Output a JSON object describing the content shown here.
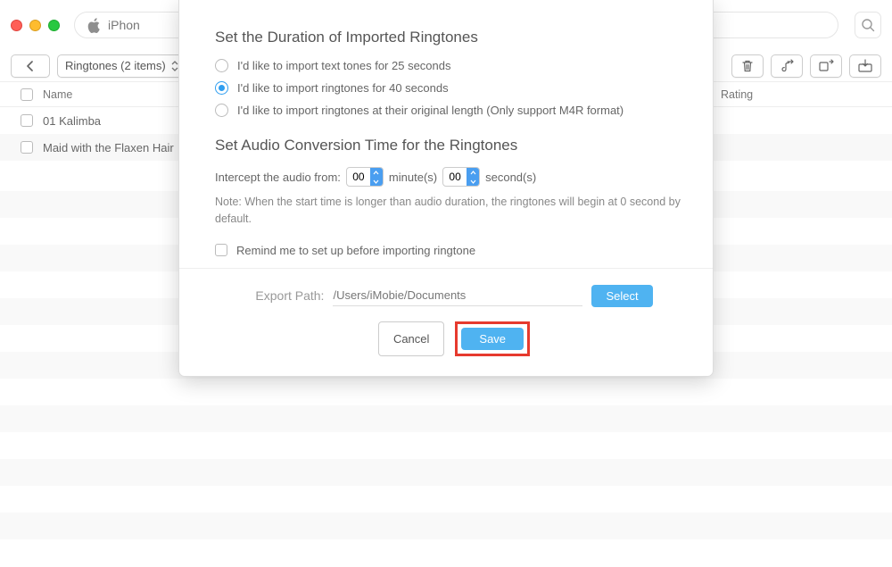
{
  "titlebar": {
    "address_text": "iPhon"
  },
  "toolbar": {
    "dropdown_label": "Ringtones (2 items)"
  },
  "table": {
    "columns": {
      "name": "Name",
      "rating": "Rating"
    },
    "rows": [
      {
        "name": "01 Kalimba"
      },
      {
        "name": "Maid with the Flaxen Hair"
      }
    ]
  },
  "modal": {
    "heading1": "Set the Duration of Imported Ringtones",
    "option1": "I'd like to import text tones for 25 seconds",
    "option2": "I'd like to import ringtones for 40 seconds",
    "option3": "I'd like to import ringtones at their original length (Only support M4R format)",
    "heading2": "Set Audio Conversion Time for the Ringtones",
    "intercept_label": "Intercept the audio from:",
    "minute_unit": "minute(s)",
    "second_unit": "second(s)",
    "minute_value": "00",
    "second_value": "00",
    "note": "Note: When the start time is longer than audio duration, the ringtones will begin at 0 second by default.",
    "remind_label": "Remind me to set up before importing ringtone",
    "export_label": "Export Path:",
    "export_value": "/Users/iMobie/Documents",
    "select": "Select",
    "cancel": "Cancel",
    "save": "Save"
  }
}
